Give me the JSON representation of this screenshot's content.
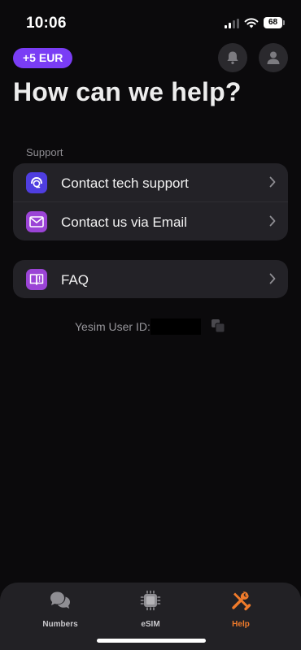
{
  "status_bar": {
    "time": "10:06",
    "battery": "68"
  },
  "header": {
    "balance": "+5 EUR",
    "title": "How can we help?"
  },
  "support": {
    "section_label": "Support",
    "items": [
      {
        "label": "Contact tech support",
        "icon": "headset-icon",
        "color": "#4f3ee0"
      },
      {
        "label": "Contact us via Email",
        "icon": "envelope-icon",
        "color": "#9b44d6"
      }
    ]
  },
  "faq": {
    "label": "FAQ",
    "icon": "book-icon",
    "color": "#9b44d6"
  },
  "user_id": {
    "label": "Yesim User ID:",
    "value": ""
  },
  "tabs": [
    {
      "label": "Numbers",
      "icon": "chat-bubbles-icon",
      "active": false
    },
    {
      "label": "eSIM",
      "icon": "sim-chip-icon",
      "active": false
    },
    {
      "label": "Help",
      "icon": "tools-icon",
      "active": true
    }
  ],
  "colors": {
    "accent": "#7a3df5",
    "active_tab": "#f07b2b",
    "background": "#0b0a0c",
    "card": "#232227"
  }
}
